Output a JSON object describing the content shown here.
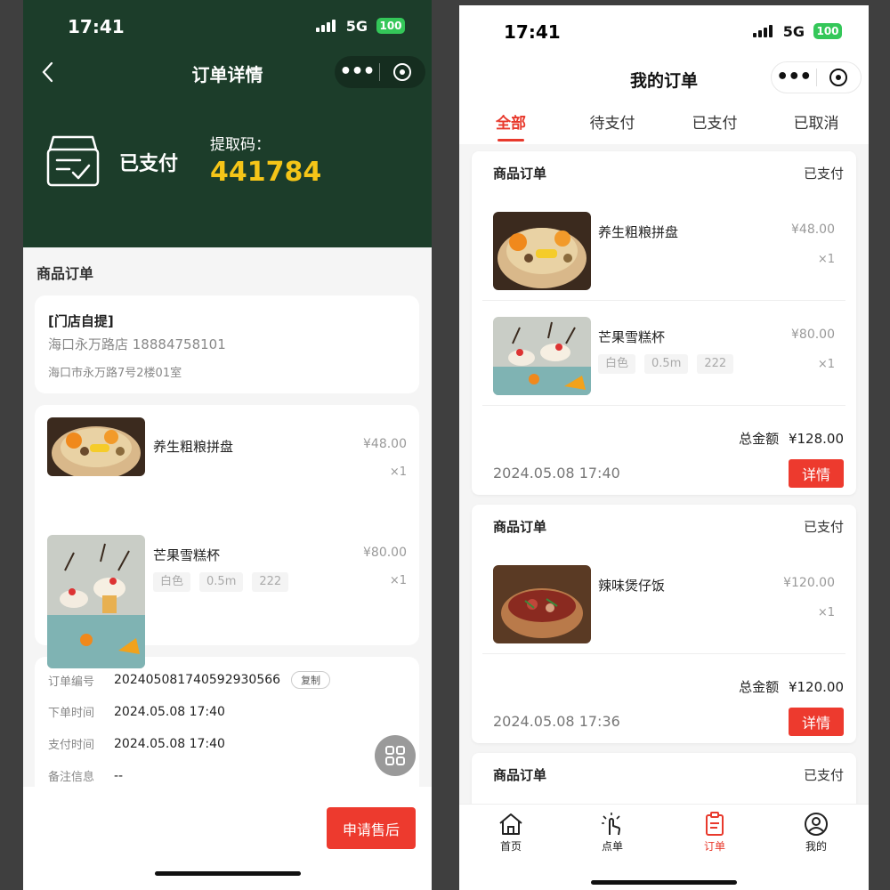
{
  "left": {
    "status_bar": {
      "time": "17:41",
      "network": "5G",
      "battery": "100"
    },
    "nav_title": "订单详情",
    "order_status": "已支付",
    "pickup_label": "提取码：",
    "pickup_code": "441784",
    "section_title": "商品订单",
    "store": {
      "type": "[门店自提]",
      "name_phone": "海口永万路店 18884758101",
      "address": "海口市永万路7号2楼01室"
    },
    "items": [
      {
        "name": "养生粗粮拼盘",
        "price": "¥48.00",
        "qty": "×1",
        "specs": []
      },
      {
        "name": "芒果雪糕杯",
        "price": "¥80.00",
        "qty": "×1",
        "specs": [
          "白色",
          "0.5m",
          "222"
        ]
      }
    ],
    "info": {
      "order_no_label": "订单编号",
      "order_no": "2024050817405929305​66",
      "copy_label": "复制",
      "order_time_label": "下单时间",
      "order_time": "2024.05.08 17:40",
      "pay_time_label": "支付时间",
      "pay_time": "2024.05.08 17:40",
      "remark_label": "备注信息",
      "remark": "--"
    },
    "after_sale_label": "申请售后"
  },
  "right": {
    "status_bar": {
      "time": "17:41",
      "network": "5G",
      "battery": "100"
    },
    "nav_title": "我的订单",
    "tabs": [
      "全部",
      "待支付",
      "已支付",
      "已取消"
    ],
    "orders": [
      {
        "title": "商品订单",
        "status": "已支付",
        "items": [
          {
            "name": "养生粗粮拼盘",
            "price": "¥48.00",
            "qty": "×1",
            "specs": []
          },
          {
            "name": "芒果雪糕杯",
            "price": "¥80.00",
            "qty": "×1",
            "specs": [
              "白色",
              "0.5m",
              "222"
            ]
          }
        ],
        "total_label": "总金额",
        "total": "¥128.00",
        "time": "2024.05.08 17:40",
        "detail_label": "详情"
      },
      {
        "title": "商品订单",
        "status": "已支付",
        "items": [
          {
            "name": "辣味煲仔饭",
            "price": "¥120.00",
            "qty": "×1",
            "specs": []
          }
        ],
        "total_label": "总金额",
        "total": "¥120.00",
        "time": "2024.05.08 17:36",
        "detail_label": "详情"
      },
      {
        "title": "商品订单",
        "status": "已支付"
      }
    ],
    "tabbar": [
      {
        "label": "首页",
        "icon": "home-icon"
      },
      {
        "label": "点单",
        "icon": "tap-icon"
      },
      {
        "label": "订单",
        "icon": "clipboard-icon"
      },
      {
        "label": "我的",
        "icon": "user-icon"
      }
    ]
  },
  "colors": {
    "header_green": "#1c3d2a",
    "pickup_gold": "#f5c518",
    "accent_red": "#e8392c",
    "button_red": "#ed3a2e"
  }
}
